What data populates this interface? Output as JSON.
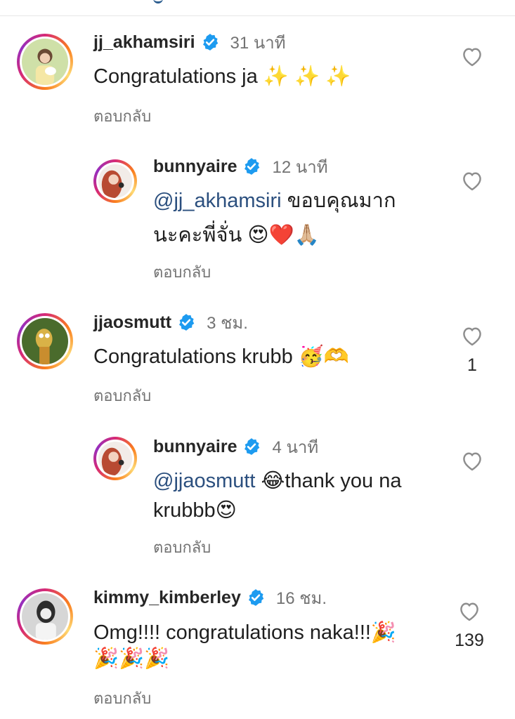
{
  "comments": [
    {
      "username": "jj_akhamsiri",
      "time": "31 นาที",
      "text": "Congratulations ja ✨ ✨ ✨",
      "reply_label": "ตอบกลับ",
      "avatar": "woman-with-dog-photo"
    },
    {
      "username": "bunnyaire",
      "time": "12 นาที",
      "mention": "@jj_akhamsiri",
      "text_line1": " ขอบคุณมาก",
      "text_line2": "นะคะพี่จั่น 😍❤️🙏🏼",
      "reply_label": "ตอบกลับ",
      "avatar": "woman-red-hair-photo"
    },
    {
      "username": "jjaosmutt",
      "time": "3 ชม.",
      "text": "Congratulations krubb 🥳🫶",
      "reply_label": "ตอบกลับ",
      "likes": "1",
      "avatar": "cartoon-character-photo"
    },
    {
      "username": "bunnyaire",
      "time": "4 นาที",
      "mention": "@jjaosmutt",
      "text_line1": " 😂thank you na",
      "text_line2": "krubbb😍",
      "reply_label": "ตอบกลับ",
      "avatar": "woman-red-hair-photo"
    },
    {
      "username": "kimmy_kimberley",
      "time": "16 ชม.",
      "text_line1": "Omg!!!! congratulations naka!!!🎉",
      "text_line2": "🎉🎉🎉",
      "reply_label": "ตอบกลับ",
      "likes": "139",
      "avatar": "woman-black-white-photo"
    }
  ],
  "colors": {
    "mention": "#2b4f7e",
    "verified": "#1d9bf0",
    "secondary_text": "#737373"
  },
  "icons": {
    "like": "heart-outline-icon",
    "verified": "verified-badge-icon"
  }
}
